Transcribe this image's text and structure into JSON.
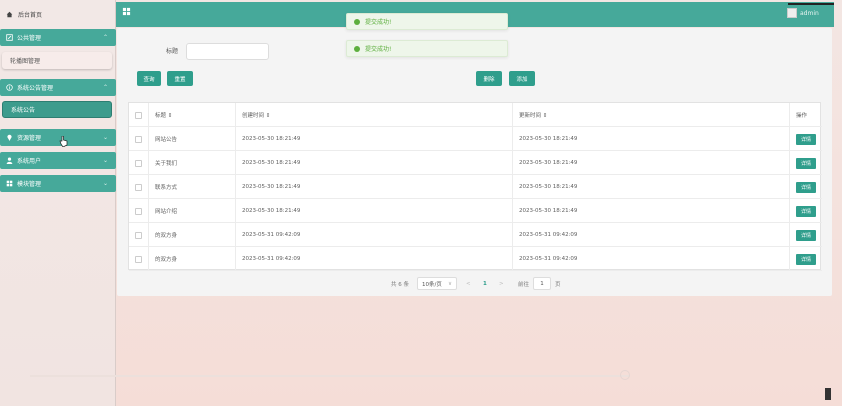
{
  "sidebar": {
    "home": "后台首页",
    "menus": [
      {
        "label": "公共管理",
        "icon": "edit-icon"
      },
      {
        "label": "系统公告管理",
        "icon": "info-icon"
      },
      {
        "label": "资源管理",
        "icon": "pin-icon"
      },
      {
        "label": "系统用户",
        "icon": "user-icon"
      },
      {
        "label": "模块管理",
        "icon": "grid-icon"
      }
    ],
    "submenus": [
      "轮播图管理",
      "系统公告"
    ]
  },
  "header": {
    "user": "admin"
  },
  "toasts": [
    "提交成功!",
    "提交成功!"
  ],
  "search": {
    "label": "标题",
    "query_button": "查询",
    "reset_button": "重置",
    "delete_button": "删除",
    "add_button": "添加"
  },
  "table": {
    "headers": [
      "标题 ⇕",
      "创建时间 ⇕",
      "更新时间 ⇕",
      "操作"
    ],
    "rows": [
      {
        "title": "网站公告",
        "created": "2023-05-30 18:21:49",
        "updated": "2023-05-30 18:21:49",
        "action": "详情"
      },
      {
        "title": "关于我们",
        "created": "2023-05-30 18:21:49",
        "updated": "2023-05-30 18:21:49",
        "action": "详情"
      },
      {
        "title": "联系方式",
        "created": "2023-05-30 18:21:49",
        "updated": "2023-05-30 18:21:49",
        "action": "详情"
      },
      {
        "title": "网站介绍",
        "created": "2023-05-30 18:21:49",
        "updated": "2023-05-30 18:21:49",
        "action": "详情"
      },
      {
        "title": "的双方身",
        "created": "2023-05-31 09:42:09",
        "updated": "2023-05-31 09:42:09",
        "action": "详情"
      },
      {
        "title": "的双方身",
        "created": "2023-05-31 09:42:09",
        "updated": "2023-05-31 09:42:09",
        "action": "详情"
      }
    ]
  },
  "pagination": {
    "total": "共 6 条",
    "page_size": "10条/页",
    "page_size_arrow": "∨",
    "prev": "<",
    "current": "1",
    "next": ">",
    "goto_label": "前往",
    "goto_value": "1",
    "page_unit": "页"
  },
  "colors": {
    "primary": "#46a99a",
    "button": "#2f9e8c",
    "success": "#5daf3e"
  }
}
